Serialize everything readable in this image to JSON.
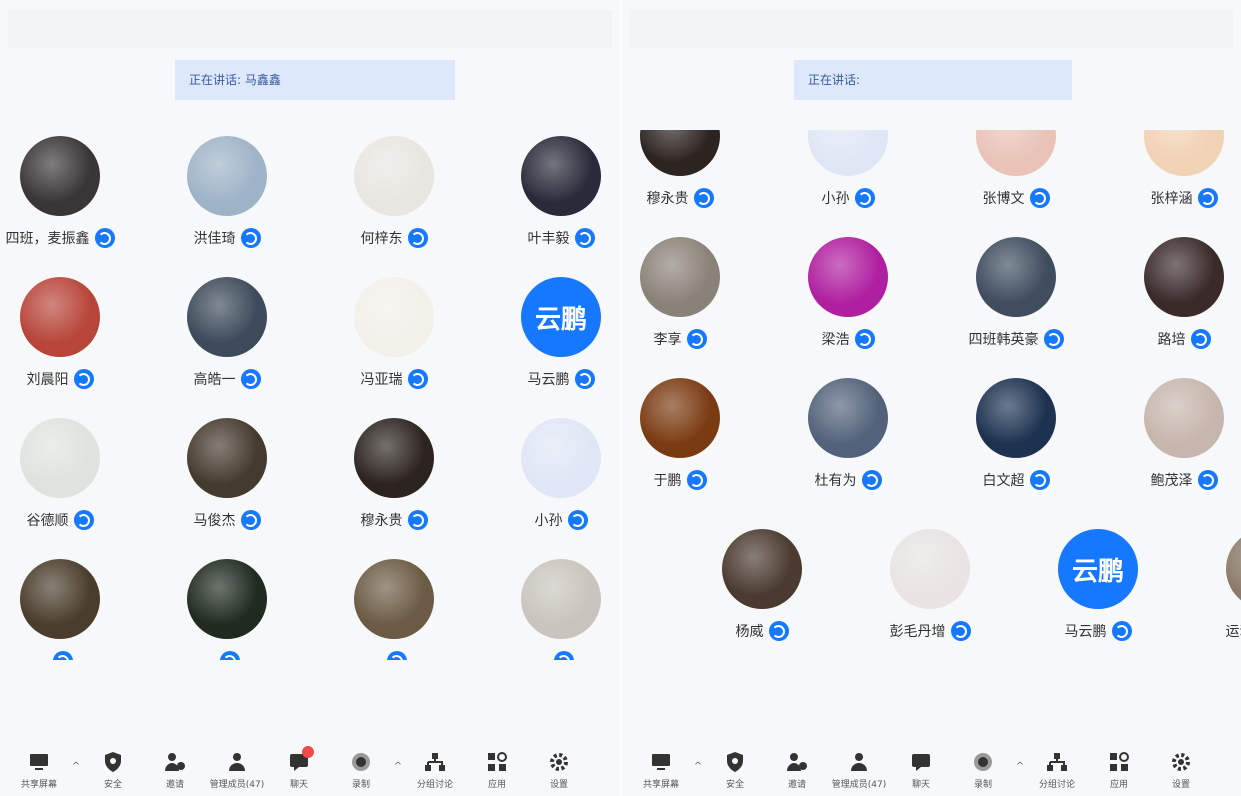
{
  "left": {
    "speaking": "正在讲话: 马鑫鑫",
    "participants": [
      {
        "name": "四班，麦振鑫",
        "c": "#3a3638"
      },
      {
        "name": "洪佳琦",
        "c": "#9fb3c7"
      },
      {
        "name": "何梓东",
        "c": "#e9e6e1"
      },
      {
        "name": "叶丰毅",
        "c": "#2a2a3a"
      },
      {
        "name": "刘晨阳",
        "c": "#b8453a"
      },
      {
        "name": "高皓一",
        "c": "#3d4a5a"
      },
      {
        "name": "冯亚瑞",
        "c": "#f3f0ea"
      },
      {
        "name": "马云鹏",
        "text": "云鹏"
      },
      {
        "name": "谷德顺",
        "c": "#dfe3de"
      },
      {
        "name": "马俊杰",
        "c": "#453a2e"
      },
      {
        "name": "穆永贵",
        "c": "#2c2420"
      },
      {
        "name": "小孙",
        "c": "#dfe6f5"
      },
      {
        "name": "",
        "c": "#4a3d2c"
      },
      {
        "name": "",
        "c": "#1f2a20"
      },
      {
        "name": "",
        "c": "#6b5b44"
      },
      {
        "name": "",
        "c": "#c9c4bd"
      }
    ],
    "toolbar": [
      {
        "label": "共享屏幕",
        "icon": "screen-share-icon",
        "caret": true
      },
      {
        "label": "安全",
        "icon": "shield-icon"
      },
      {
        "label": "邀请",
        "icon": "invite-icon"
      },
      {
        "label": "管理成员(47)",
        "icon": "members-icon"
      },
      {
        "label": "聊天",
        "icon": "chat-icon",
        "dot": true
      },
      {
        "label": "录制",
        "icon": "record-icon",
        "caret": true
      },
      {
        "label": "分组讨论",
        "icon": "breakout-icon"
      },
      {
        "label": "应用",
        "icon": "apps-icon"
      },
      {
        "label": "设置",
        "icon": "gear-icon"
      }
    ]
  },
  "right": {
    "speaking": "正在讲话:",
    "participants": [
      {
        "name": "穆永贵",
        "c": "#2c2420"
      },
      {
        "name": "小孙",
        "c": "#dfe6f5"
      },
      {
        "name": "张博文",
        "c": "#e9c3b8"
      },
      {
        "name": "张梓涵",
        "c": "#f1d2b5"
      },
      {
        "name": "李享",
        "c": "#8a8278"
      },
      {
        "name": "梁浩",
        "c": "#b01fa0"
      },
      {
        "name": "四班韩英豪",
        "c": "#3f4d5f"
      },
      {
        "name": "路培",
        "c": "#3a2a2a"
      },
      {
        "name": "于鹏",
        "c": "#7a3b12"
      },
      {
        "name": "杜有为",
        "c": "#52627a"
      },
      {
        "name": "白文超",
        "c": "#1d3250"
      },
      {
        "name": "鲍茂泽",
        "c": "#c7b6ad"
      },
      {
        "name": "杨威",
        "c": "#4a3a30"
      },
      {
        "name": "彭毛丹增",
        "c": "#e9e3e3"
      },
      {
        "name": "马云鹏",
        "text": "云鹏"
      },
      {
        "name": "运动四班",
        "c": "#8a7a6a"
      }
    ],
    "toolbar": [
      {
        "label": "共享屏幕",
        "icon": "screen-share-icon",
        "caret": true
      },
      {
        "label": "安全",
        "icon": "shield-icon"
      },
      {
        "label": "邀请",
        "icon": "invite-icon"
      },
      {
        "label": "管理成员(47)",
        "icon": "members-icon"
      },
      {
        "label": "聊天",
        "icon": "chat-icon"
      },
      {
        "label": "录制",
        "icon": "record-icon",
        "caret": true
      },
      {
        "label": "分组讨论",
        "icon": "breakout-icon"
      },
      {
        "label": "应用",
        "icon": "apps-icon"
      },
      {
        "label": "设置",
        "icon": "gear-icon"
      }
    ]
  }
}
